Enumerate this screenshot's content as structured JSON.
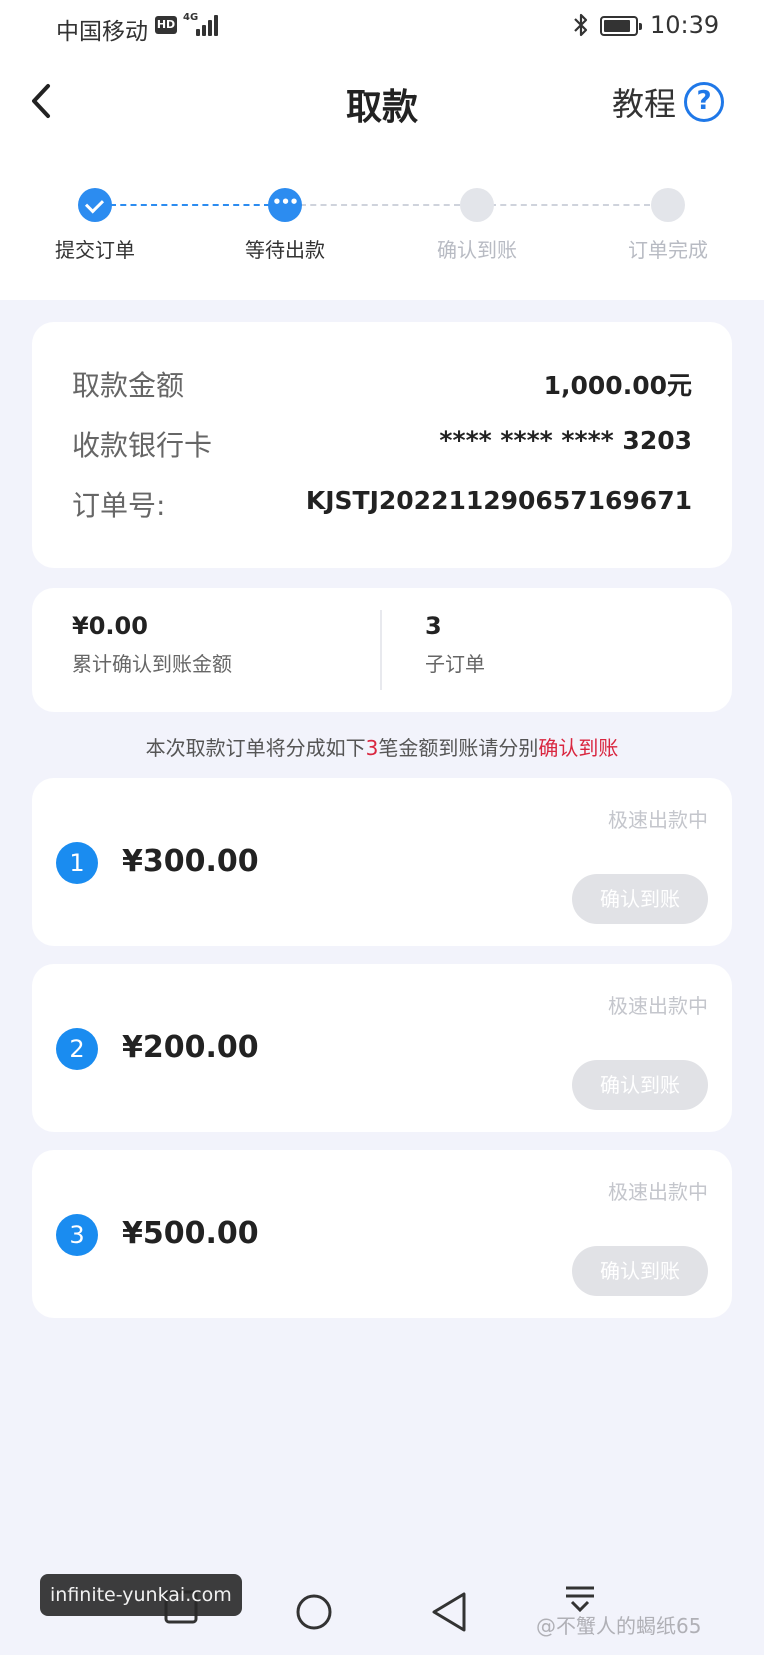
{
  "status_bar": {
    "carrier": "中国移动",
    "hd": "HD",
    "network": "4G",
    "time": "10:39",
    "battery_level": 0.85
  },
  "header": {
    "title": "取款",
    "tutorial_label": "教程",
    "help_icon_glyph": "?"
  },
  "stepper": {
    "steps": [
      {
        "label": "提交订单",
        "state": "done"
      },
      {
        "label": "等待出款",
        "state": "current"
      },
      {
        "label": "确认到账",
        "state": "pending"
      },
      {
        "label": "订单完成",
        "state": "pending"
      }
    ],
    "current_glyph": "•••"
  },
  "order_info": {
    "rows": [
      {
        "label": "取款金额",
        "value": "1,000.00元"
      },
      {
        "label": "收款银行卡",
        "value": "**** **** **** 3203"
      },
      {
        "label": "订单号:",
        "value": "KJSTJ20221129065716967​1"
      }
    ]
  },
  "stats": {
    "confirmed_amount": "¥0.00",
    "confirmed_label": "累计确认到账金额",
    "sub_order_count": "3",
    "sub_order_label": "子订单"
  },
  "notice": {
    "prefix": "本次取款订单将分成如下",
    "count": "3",
    "middle": "笔金额到账请分别",
    "action": "确认到账"
  },
  "sub_orders": [
    {
      "index": "1",
      "amount": "¥300.00",
      "status": "极速出款中",
      "button_label": "确认到账"
    },
    {
      "index": "2",
      "amount": "¥200.00",
      "status": "极速出款中",
      "button_label": "确认到账"
    },
    {
      "index": "3",
      "amount": "¥500.00",
      "status": "极速出款中",
      "button_label": "确认到账"
    }
  ],
  "watermarks": {
    "left": "infinite-yunkai.com",
    "right": "@不蟹人的蝎纸65"
  },
  "colors": {
    "accent": "#2c8cf0",
    "highlight": "#d9263f",
    "background": "#f2f3fb"
  }
}
